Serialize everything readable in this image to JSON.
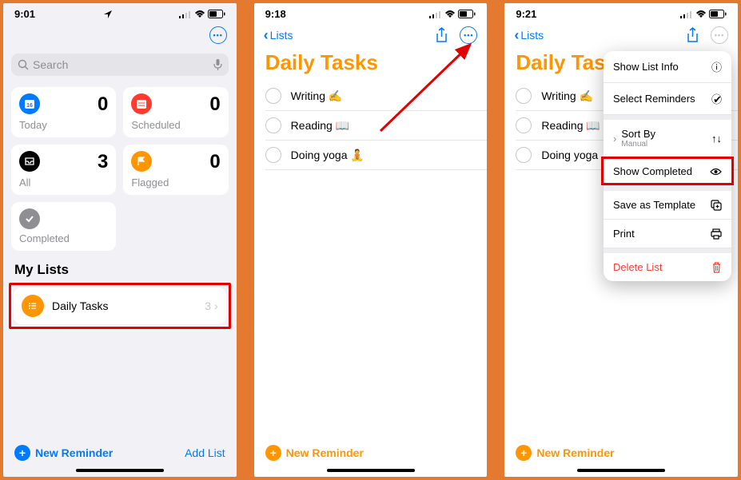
{
  "screen1": {
    "time": "9:01",
    "search_placeholder": "Search",
    "cards": {
      "today": {
        "label": "Today",
        "count": "0"
      },
      "scheduled": {
        "label": "Scheduled",
        "count": "0"
      },
      "all": {
        "label": "All",
        "count": "3"
      },
      "flagged": {
        "label": "Flagged",
        "count": "0"
      },
      "completed": {
        "label": "Completed"
      }
    },
    "my_lists_title": "My Lists",
    "list": {
      "name": "Daily Tasks",
      "count": "3"
    },
    "new_reminder": "New Reminder",
    "add_list": "Add List"
  },
  "screen2": {
    "time": "9:18",
    "back": "Lists",
    "title": "Daily Tasks",
    "items": [
      "Writing ✍️",
      "Reading 📖",
      "Doing yoga 🧘"
    ],
    "new_reminder": "New Reminder"
  },
  "screen3": {
    "time": "9:21",
    "back": "Lists",
    "title": "Daily Tasks",
    "items": [
      "Writing ✍️",
      "Reading 📖",
      "Doing yoga 🧘"
    ],
    "new_reminder": "New Reminder",
    "menu": {
      "show_list_info": "Show List Info",
      "select_reminders": "Select Reminders",
      "sort_by": "Sort By",
      "sort_by_value": "Manual",
      "show_completed": "Show Completed",
      "save_as_template": "Save as Template",
      "print": "Print",
      "delete_list": "Delete List"
    }
  }
}
